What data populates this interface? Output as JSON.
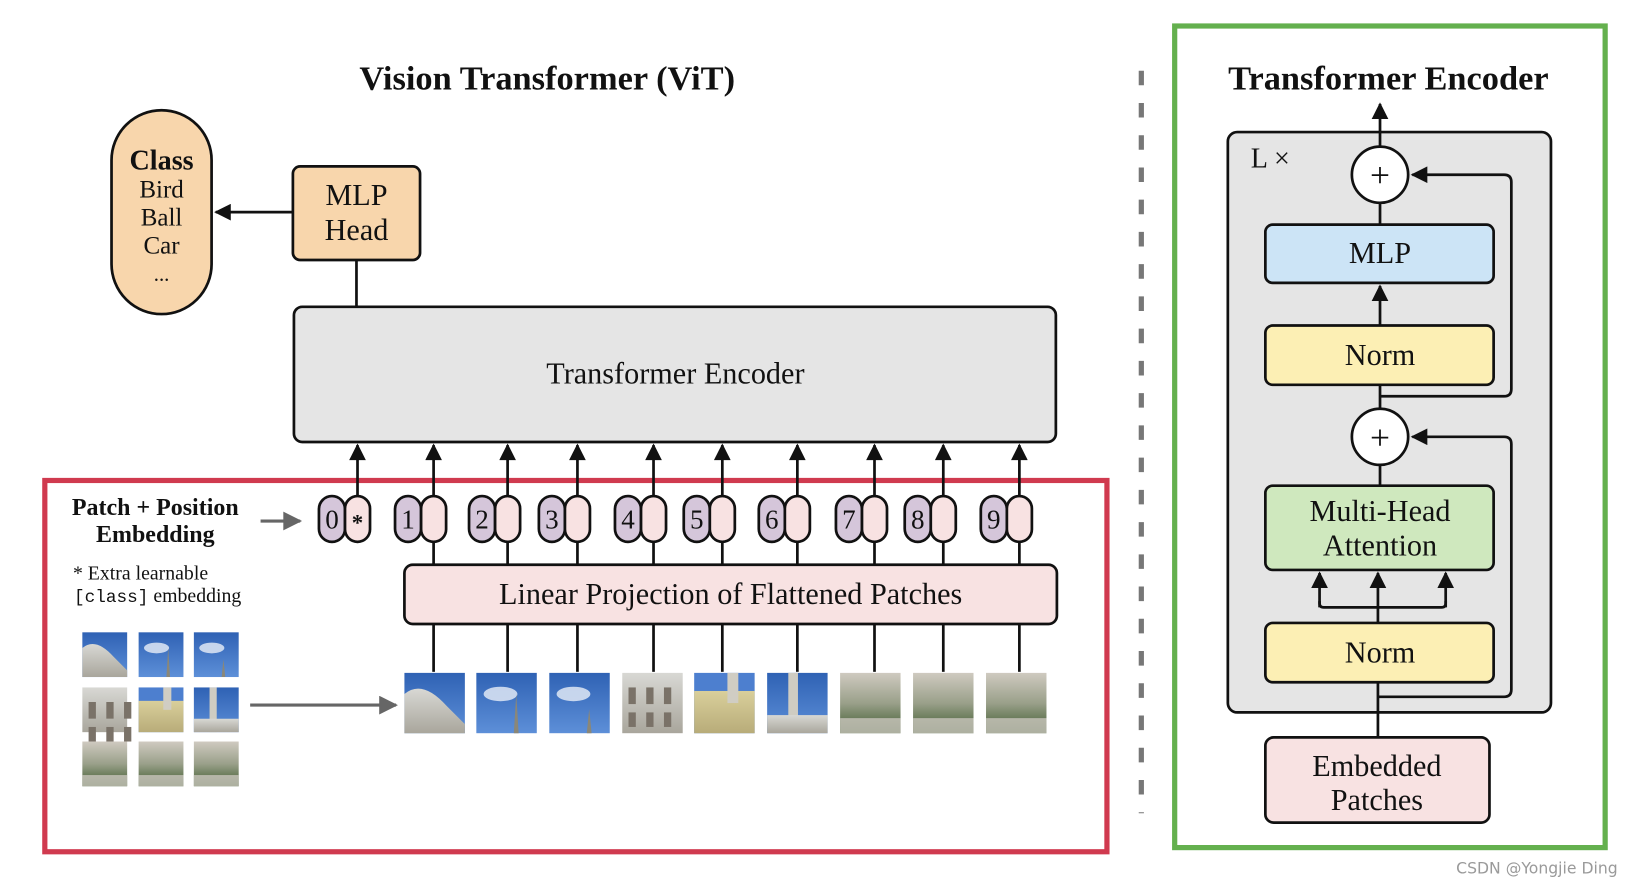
{
  "vit": {
    "title": "Vision Transformer (ViT)",
    "class_box": {
      "heading": "Class",
      "items": [
        "Bird",
        "Ball",
        "Car",
        "..."
      ]
    },
    "mlp_head": {
      "line1": "MLP",
      "line2": "Head"
    },
    "transformer_encoder": "Transformer Encoder",
    "patch_position_label": {
      "line1": "Patch + Position",
      "line2": "Embedding"
    },
    "extra_note": {
      "line1": "* Extra learnable",
      "code": "[class]",
      "line2_rest": " embedding"
    },
    "tokens": [
      "0",
      "1",
      "2",
      "3",
      "4",
      "5",
      "6",
      "7",
      "8",
      "9"
    ],
    "class_token_mark": "*",
    "linear_projection": "Linear Projection of Flattened Patches",
    "patch_count": 9
  },
  "encoder_detail": {
    "title": "Transformer Encoder",
    "repeat_label": "L ×",
    "add_symbol": "+",
    "mlp": "MLP",
    "norm_top": "Norm",
    "mha": {
      "line1": "Multi-Head",
      "line2": "Attention"
    },
    "norm_bottom": "Norm",
    "embedded": {
      "line1": "Embedded",
      "line2": "Patches"
    }
  },
  "colors": {
    "highlight_left": "#d03a4f",
    "highlight_right": "#64b04e",
    "class_fill": "#f8d6ac",
    "encoder_fill": "#e5e5e5",
    "position_token": "#d5c6da",
    "patch_token": "#f8e2e2",
    "mlp_fill": "#cce4f6",
    "norm_fill": "#fcefb4",
    "mha_fill": "#cfe8be",
    "embedded_fill": "#f8e2e2",
    "divider": "#777777"
  },
  "watermark": "CSDN @Yongjie Ding"
}
